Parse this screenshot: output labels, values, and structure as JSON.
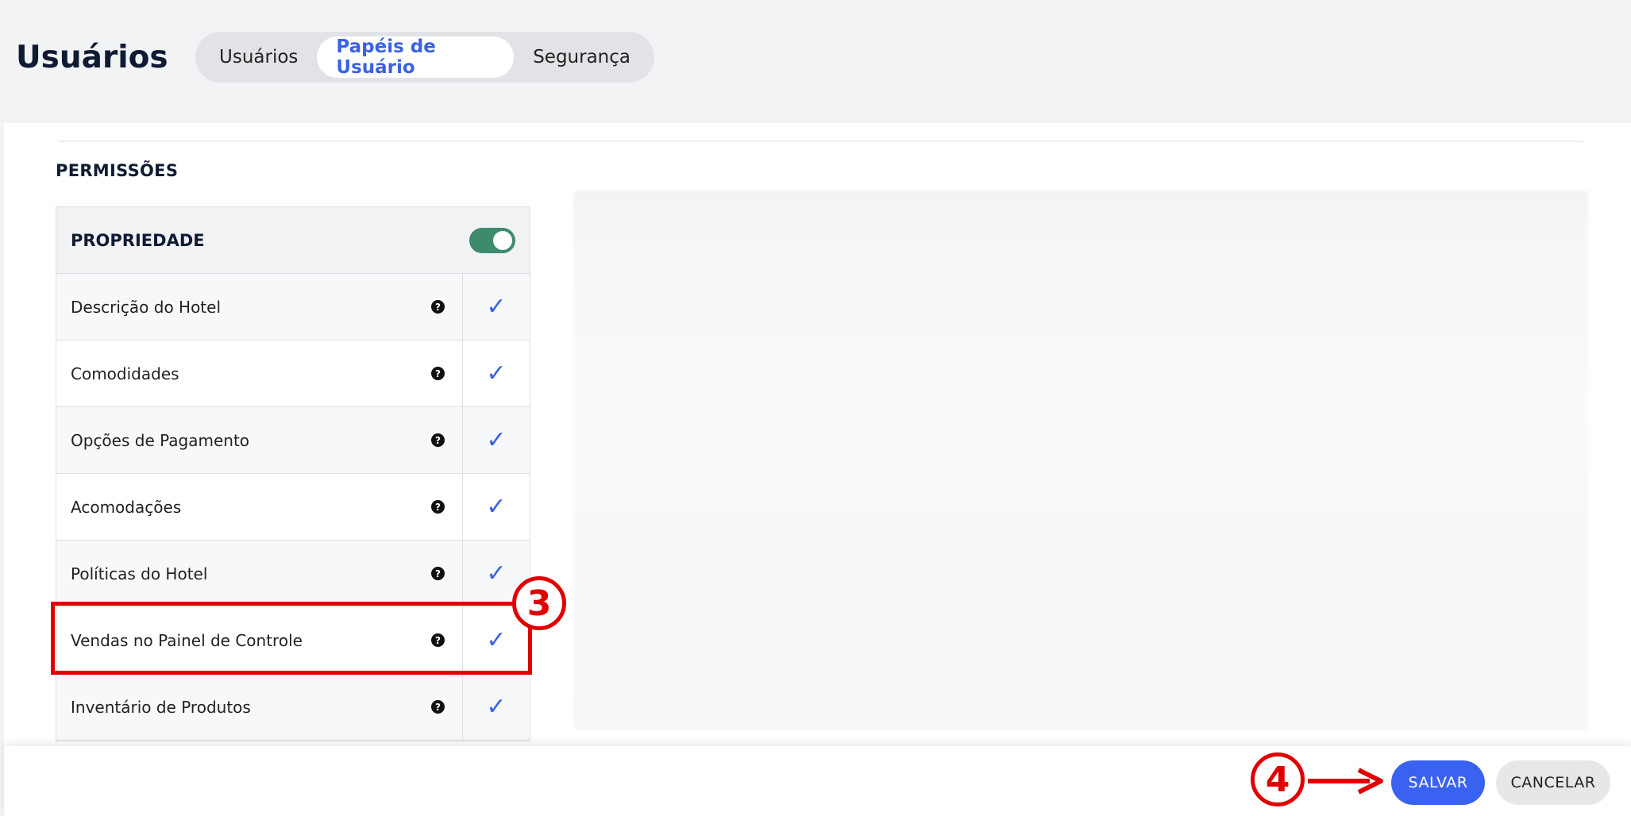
{
  "header": {
    "title": "Usuários",
    "tabs": [
      {
        "label": "Usuários",
        "active": false
      },
      {
        "label": "Papéis de Usuário",
        "active": true
      },
      {
        "label": "Segurança",
        "active": false
      }
    ]
  },
  "permissions": {
    "section_label": "PERMISSÕES",
    "group": {
      "label": "PROPRIEDADE",
      "toggle_on": true
    },
    "rows": [
      {
        "name": "Descrição do Hotel",
        "checked": true
      },
      {
        "name": "Comodidades",
        "checked": true
      },
      {
        "name": "Opções de Pagamento",
        "checked": true
      },
      {
        "name": "Acomodações",
        "checked": true
      },
      {
        "name": "Políticas do Hotel",
        "checked": true
      },
      {
        "name": "Vendas no Painel de Controle",
        "checked": true
      },
      {
        "name": "Inventário de Produtos",
        "checked": true
      }
    ],
    "help_glyph": "?",
    "check_glyph": "✓"
  },
  "footer": {
    "save_label": "SALVAR",
    "cancel_label": "CANCELAR"
  },
  "annotations": {
    "step3": "3",
    "step4": "4",
    "color": "#e00000"
  },
  "colors": {
    "accent": "#3a62f0",
    "toggle": "#3d8a6c"
  },
  "icons": [
    "help-icon",
    "check-icon",
    "toggle-switch",
    "arrow-right-icon"
  ]
}
